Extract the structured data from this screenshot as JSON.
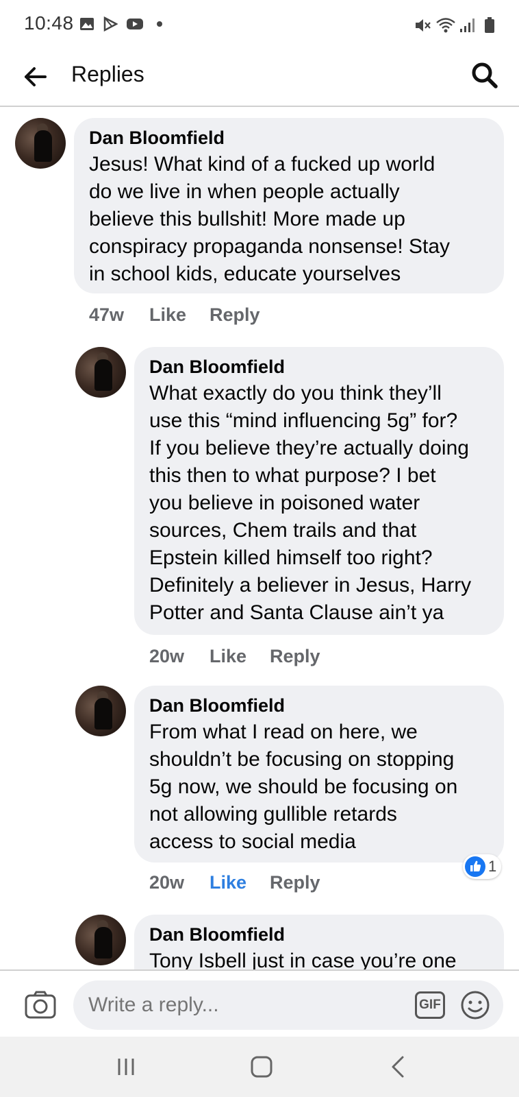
{
  "status_bar": {
    "time": "10:48",
    "left_icons": [
      "gallery-icon",
      "play-store-icon",
      "youtube-icon",
      "dot-icon"
    ],
    "right_icons": [
      "mute-icon",
      "wifi-icon",
      "signal-icon",
      "battery-icon"
    ]
  },
  "header": {
    "title": "Replies",
    "back_icon": "back-arrow-icon",
    "search_icon": "search-icon"
  },
  "comments": [
    {
      "author": "Dan Bloomfield",
      "text": [
        "Jesus! What kind of a fucked up world",
        "do we live in when people actually",
        "believe this bullshit! More made up",
        "conspiracy propaganda nonsense! Stay",
        "in school kids, educate yourselves"
      ],
      "time": "47w",
      "like_label": "Like",
      "reply_label": "Reply",
      "liked": false
    },
    {
      "author": "Dan Bloomfield",
      "text": [
        "What exactly do you think they’ll",
        "use this “mind influencing 5g” for?",
        "If you believe they’re actually doing",
        "this then to what purpose? I bet",
        "you believe in poisoned water",
        "sources, Chem trails and that",
        "Epstein killed himself too right?",
        "Definitely a believer in Jesus, Harry",
        "Potter and Santa Clause ain’t ya"
      ],
      "time": "20w",
      "like_label": "Like",
      "reply_label": "Reply",
      "liked": false
    },
    {
      "author": "Dan Bloomfield",
      "text": [
        "From what I read on here, we",
        "shouldn’t be focusing on stopping",
        "5g now, we should be focusing on",
        "not allowing gullible retards",
        "access to social media"
      ],
      "time": "20w",
      "like_label": "Like",
      "reply_label": "Reply",
      "liked": true,
      "reaction_count": "1",
      "reaction_icon": "like-reaction-icon"
    },
    {
      "author": "Dan Bloomfield",
      "text": [
        "Tony Isbell just in case you’re one"
      ]
    }
  ],
  "composer": {
    "placeholder": "Write a reply...",
    "camera_icon": "camera-icon",
    "gif_label": "GIF",
    "emoji_icon": "emoji-icon"
  },
  "nav_bar": {
    "icons": [
      "recent-apps-icon",
      "home-icon",
      "back-icon"
    ]
  },
  "colors": {
    "bubble": "#eff0f3",
    "meta_text": "#65676b",
    "liked_blue": "#2e7fe0",
    "reaction_blue": "#1877f2"
  }
}
